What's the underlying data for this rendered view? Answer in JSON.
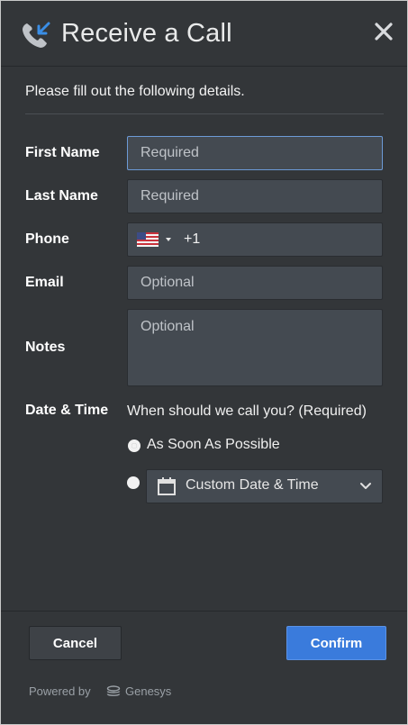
{
  "header": {
    "title": "Receive a Call",
    "icon": "incoming-call-icon",
    "close_icon": "close-icon"
  },
  "intro": "Please fill out the following details.",
  "form": {
    "first_name": {
      "label": "First Name",
      "placeholder": "Required",
      "value": ""
    },
    "last_name": {
      "label": "Last Name",
      "placeholder": "Required",
      "value": ""
    },
    "phone": {
      "label": "Phone",
      "country": "US",
      "country_code": "+1",
      "value": ""
    },
    "email": {
      "label": "Email",
      "placeholder": "Optional",
      "value": ""
    },
    "notes": {
      "label": "Notes",
      "placeholder": "Optional",
      "value": ""
    },
    "date_time": {
      "label": "Date & Time",
      "prompt": "When should we call you? (Required)",
      "option_asap": "As Soon As Possible",
      "option_custom": "Custom Date & Time",
      "selected": "asap"
    }
  },
  "footer": {
    "cancel_label": "Cancel",
    "confirm_label": "Confirm",
    "powered_by": "Powered by",
    "brand": "Genesys"
  },
  "colors": {
    "background": "#333639",
    "field": "#444a51",
    "accent": "#3a7bdc",
    "focus_border": "#6c9ad6"
  }
}
